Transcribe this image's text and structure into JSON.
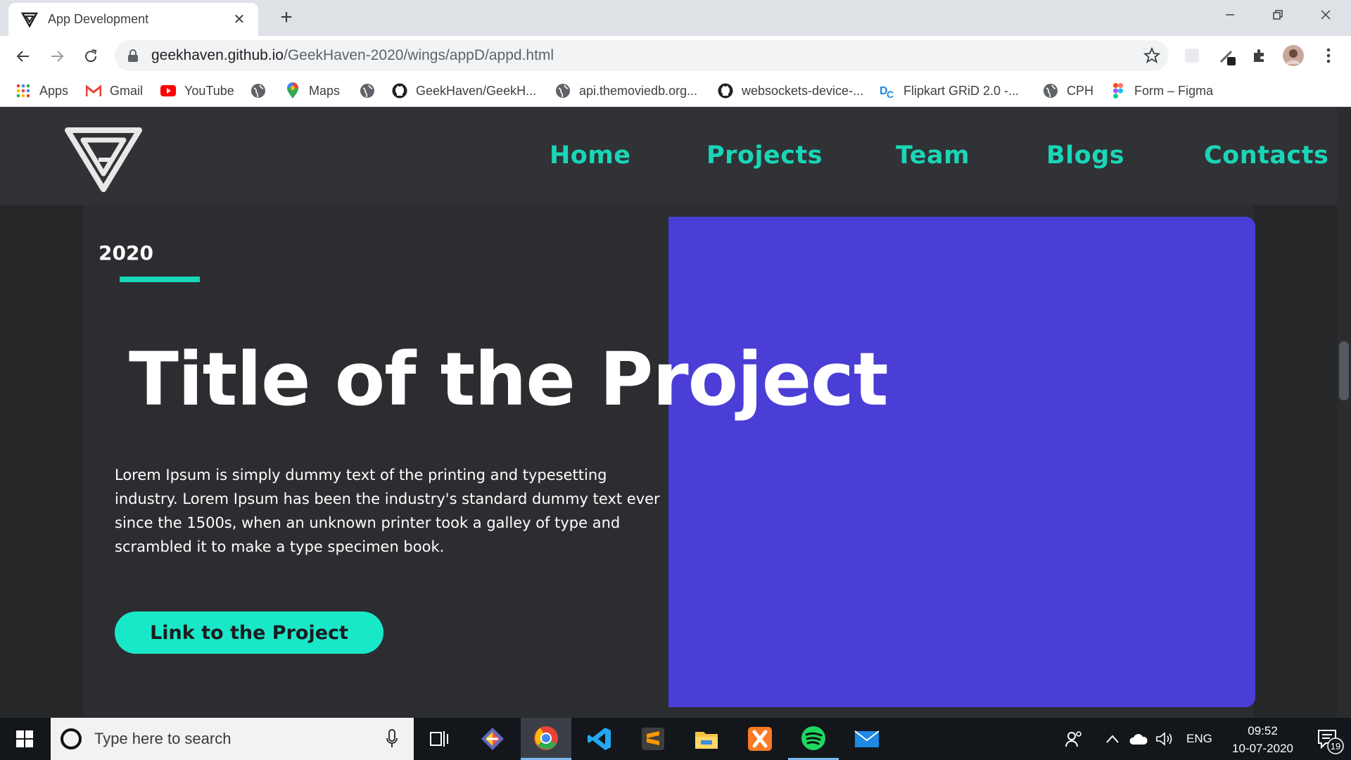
{
  "browser": {
    "tab_title": "App Development",
    "url_host": "geekhaven.github.io",
    "url_path": "/GeekHaven-2020/wings/appD/appd.html",
    "bookmarks": [
      {
        "label": "Apps",
        "icon": "apps-grid-icon"
      },
      {
        "label": "Gmail",
        "icon": "gmail-icon"
      },
      {
        "label": "YouTube",
        "icon": "youtube-icon"
      },
      {
        "label": "",
        "icon": "globe-icon"
      },
      {
        "label": "Maps",
        "icon": "maps-pin-icon"
      },
      {
        "label": "",
        "icon": "globe-icon"
      },
      {
        "label": "GeekHaven/GeekH...",
        "icon": "github-icon"
      },
      {
        "label": "api.themoviedb.org...",
        "icon": "globe-icon"
      },
      {
        "label": "websockets-device-...",
        "icon": "github-icon"
      },
      {
        "label": "Flipkart GRiD 2.0 -...",
        "icon": "dare2compete-icon"
      },
      {
        "label": "CPH",
        "icon": "globe-icon"
      },
      {
        "label": "Form – Figma",
        "icon": "figma-icon"
      }
    ]
  },
  "site": {
    "nav": [
      "Home",
      "Projects",
      "Team",
      "Blogs",
      "Contacts"
    ],
    "year": "2020",
    "title": "Title of the Project",
    "description": "Lorem Ipsum is simply dummy text of the printing and typesetting industry. Lorem Ipsum has been the industry's standard dummy text ever since the 1500s, when an unknown printer took a galley of type and scrambled it to make a type specimen book.",
    "cta": "Link to the Project"
  },
  "taskbar": {
    "search_placeholder": "Type here to search",
    "language": "ENG",
    "time": "09:52",
    "date": "10-07-2020",
    "notification_count": "19"
  },
  "colors": {
    "accent": "#19d6b6",
    "panel": "#4a3ed6",
    "page_bg": "#262729"
  }
}
